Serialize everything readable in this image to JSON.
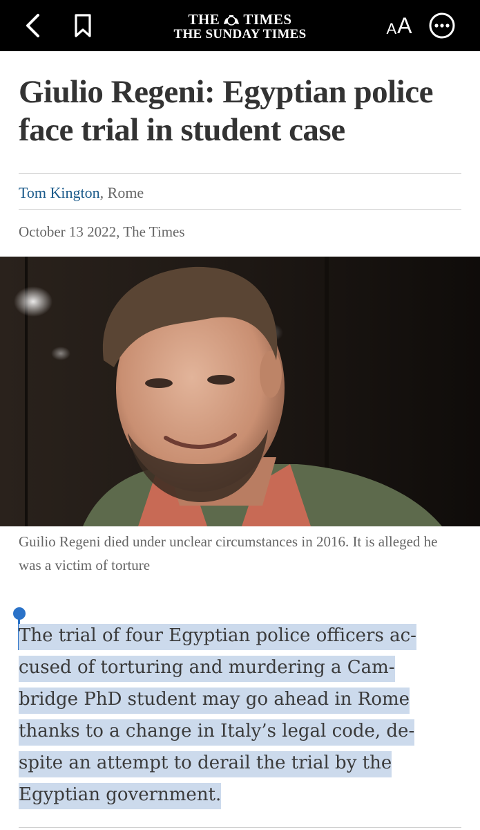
{
  "app": {
    "logo_line1_left": "THE",
    "logo_line1_right": "TIMES",
    "logo_line2": "THE SUNDAY TIMES",
    "text_size_small": "A",
    "text_size_large": "A"
  },
  "article": {
    "headline": "Giulio Regeni: Egyptian police face trial in student case",
    "author": "Tom Kington",
    "byline_rest": ", Rome",
    "dateline": "October 13 2022, The Times",
    "photo_caption": "Guilio Regeni died under unclear circumstances in 2016. It is alleged he was a victim of torture",
    "body_paragraph": "The trial of four Egyptian police officers ac­cused of torturing and murdering a Cam­bridge PhD student may go ahead in Rome thanks to a change in Italy’s legal code, de­spite an attempt to derail the trial by the Egyptian government."
  },
  "icons": {
    "back": "back-chevron-icon",
    "bookmark": "bookmark-icon",
    "more": "more-options-icon",
    "crest": "royal-crest-icon"
  },
  "colors": {
    "topbar": "#000000",
    "author_link": "#1a5a8a",
    "selection": "#ccdaec",
    "selection_handle": "#2a72c8"
  }
}
